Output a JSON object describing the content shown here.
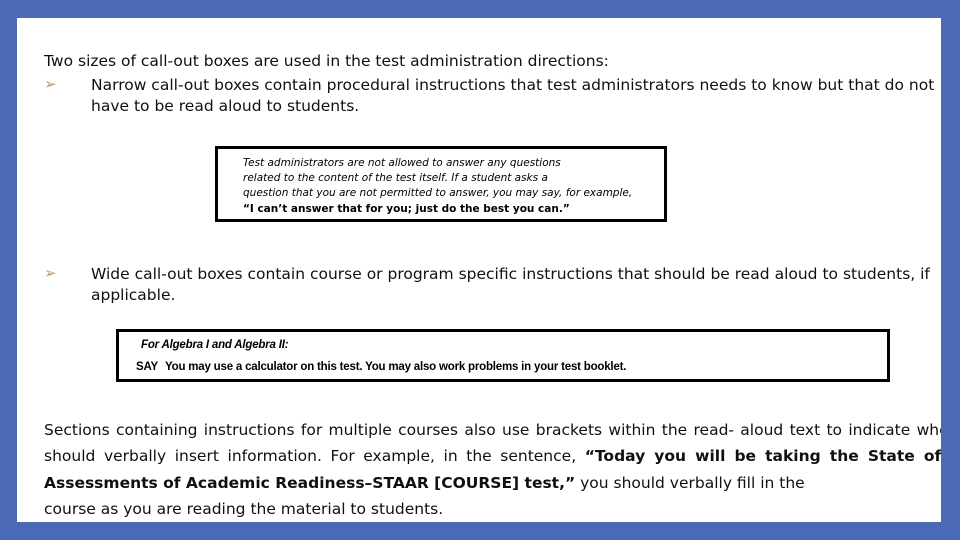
{
  "slide": {
    "frame_color": "#4a6ab5",
    "background_color": "#ffffff",
    "bullet_marker_color": "#b79a75",
    "bullet_marker_glyph": "➢"
  },
  "lead_paragraph": "Two sizes of call-out boxes are used in the test administration directions:",
  "bullets": [
    {
      "marker": "➢",
      "text": "Narrow call-out boxes contain procedural instructions that test administrators needs to know but that do not have to be read aloud to students."
    },
    {
      "marker": "➢",
      "text_main": "Wide call-out boxes contain course or program specific instructions that should be read aloud to students, if",
      "text_last": "applicable."
    }
  ],
  "callout_narrow": {
    "lines": [
      "Test administrators are not allowed to answer any questions",
      "related to the content of the test itself. If a student asks a",
      "question that you are not permitted to answer, you may say, for example,"
    ],
    "bold_line": "“I can’t answer that for you; just do the best you can.”"
  },
  "callout_wide": {
    "title": "For Algebra I and Algebra II:",
    "say_label": "SAY",
    "say_text": "You may use a calculator on this test. You may also work problems in your test booklet."
  },
  "closing_paragraph": {
    "part_1": "Sections containing instructions for multiple courses also use brackets within the read- aloud text to indicate where you should verbally insert information. For example, in the sentence, ",
    "quote_bold": "“Today you will be taking the State of Texas Assessments of Academic Readiness–STAAR [COURSE] test,”",
    "part_2": " you should verbally fill in the",
    "last_line": "course as you are reading the material to students."
  }
}
